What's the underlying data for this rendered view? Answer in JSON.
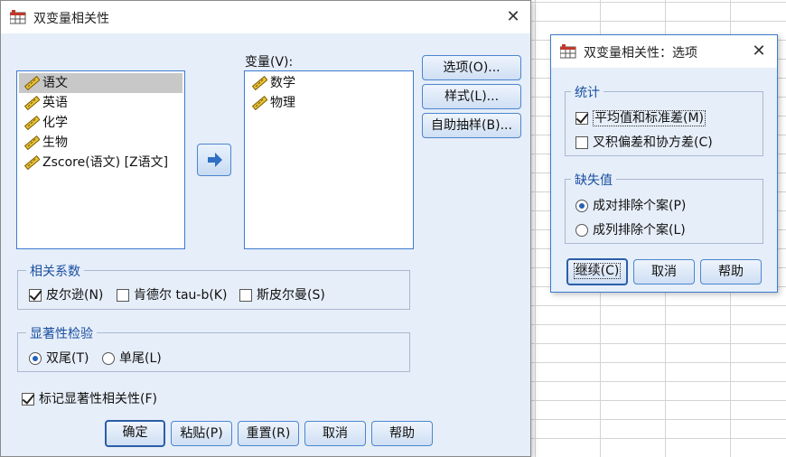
{
  "main_dialog": {
    "title": "双变量相关性",
    "source_variables": [
      "语文",
      "英语",
      "化学",
      "生物",
      "Zscore(语文) [Z语文]"
    ],
    "variables_label": "变量(V):",
    "target_variables": [
      "数学",
      "物理"
    ],
    "side_buttons": {
      "options": "选项(O)...",
      "style": "样式(L)...",
      "bootstrap": "自助抽样(B)..."
    },
    "correlation_group": {
      "label": "相关系数",
      "pearson": "皮尔逊(N)",
      "kendall": "肯德尔 tau-b(K)",
      "spearman": "斯皮尔曼(S)"
    },
    "significance_group": {
      "label": "显著性检验",
      "two_tailed": "双尾(T)",
      "one_tailed": "单尾(L)"
    },
    "flag_significant": "标记显著性相关性(F)",
    "footer_buttons": {
      "ok": "确定",
      "paste": "粘贴(P)",
      "reset": "重置(R)",
      "cancel": "取消",
      "help": "帮助"
    }
  },
  "options_dialog": {
    "title": "双变量相关性：选项",
    "statistics_group": {
      "label": "统计",
      "means_sd": "平均值和标准差(M)",
      "cross_products": "叉积偏差和协方差(C)"
    },
    "missing_group": {
      "label": "缺失值",
      "pairwise": "成对排除个案(P)",
      "listwise": "成列排除个案(L)"
    },
    "buttons": {
      "continue": "继续(C)",
      "cancel": "取消",
      "help": "帮助"
    }
  }
}
